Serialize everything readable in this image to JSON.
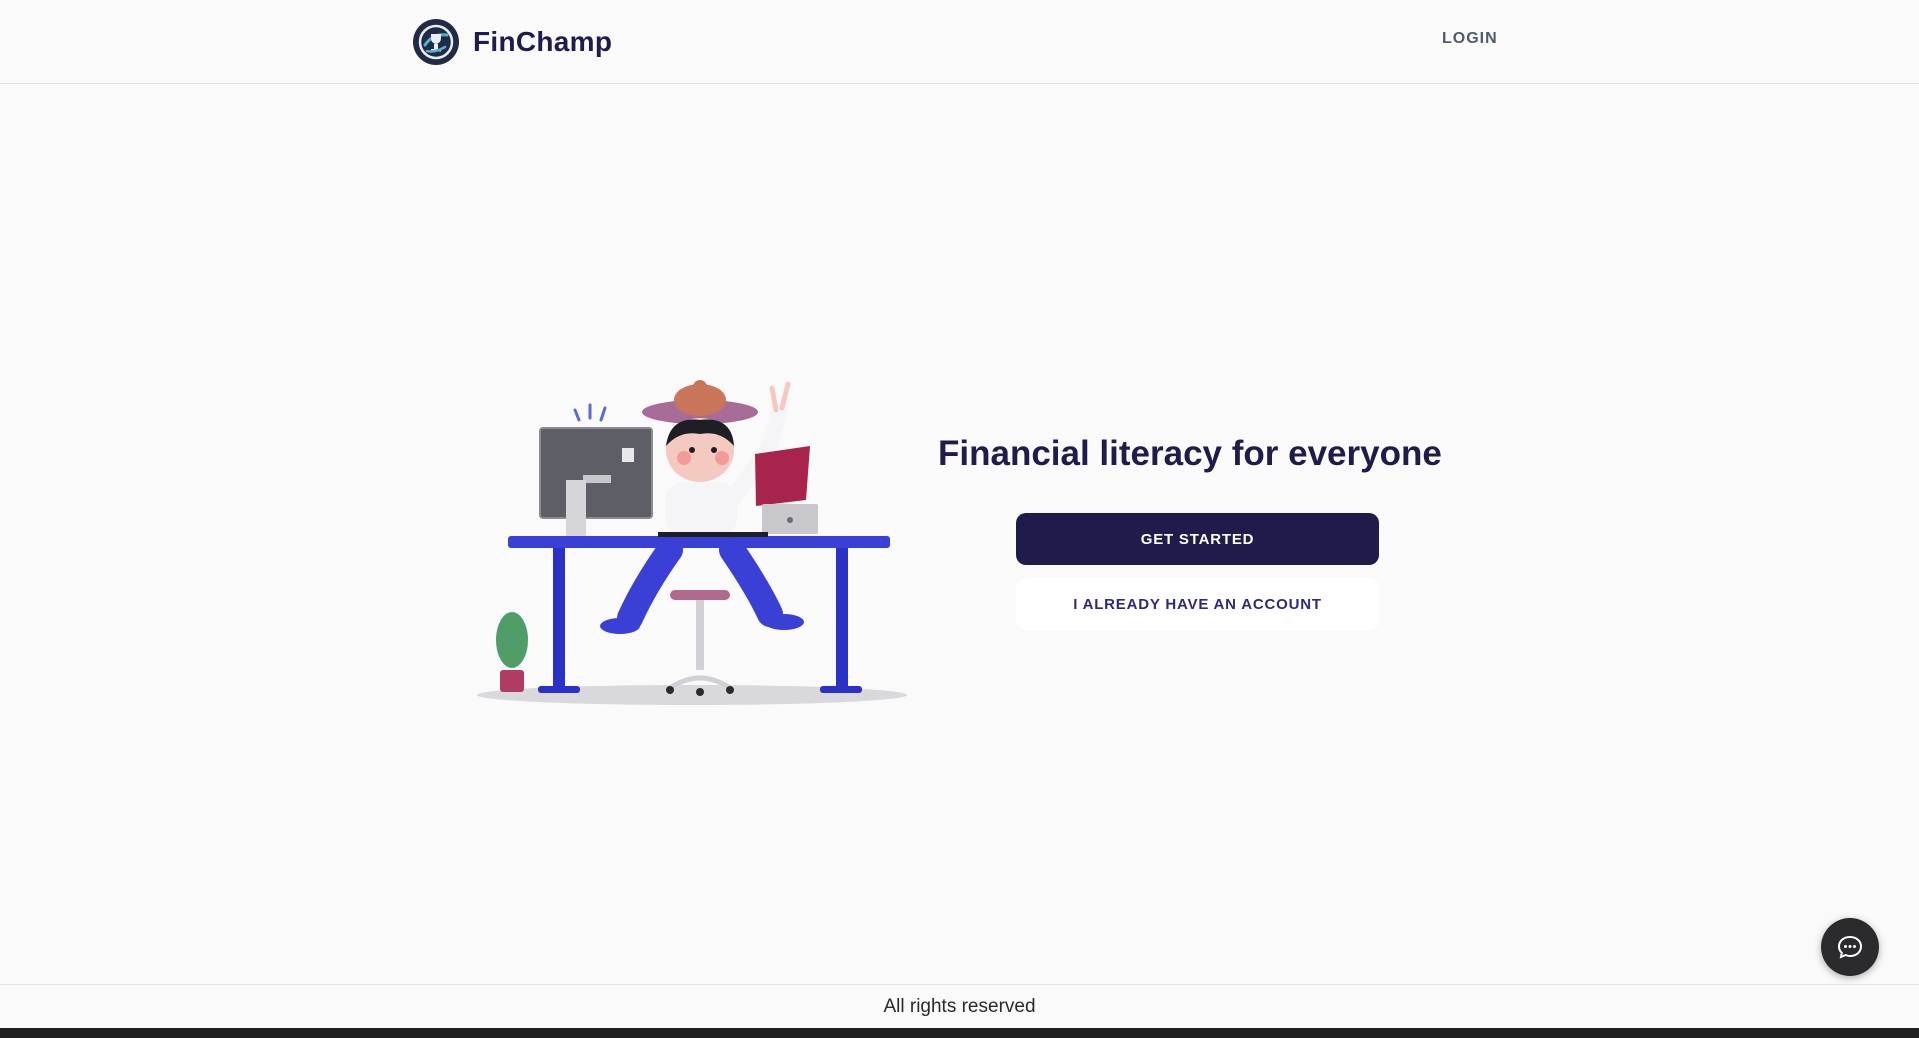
{
  "header": {
    "brand_name": "FinChamp",
    "login_label": "LOGIN"
  },
  "hero": {
    "headline": "Financial literacy for everyone",
    "get_started_label": "GET STARTED",
    "have_account_label": "I ALREADY HAVE AN ACCOUNT"
  },
  "footer": {
    "text": "All rights reserved"
  },
  "icons": {
    "brand": "finchamp-logo-icon",
    "chat": "chat-bubble-icon"
  },
  "colors": {
    "primary": "#1f1b4a",
    "background": "#fafafb",
    "secondary_text": "#2e2a78"
  }
}
